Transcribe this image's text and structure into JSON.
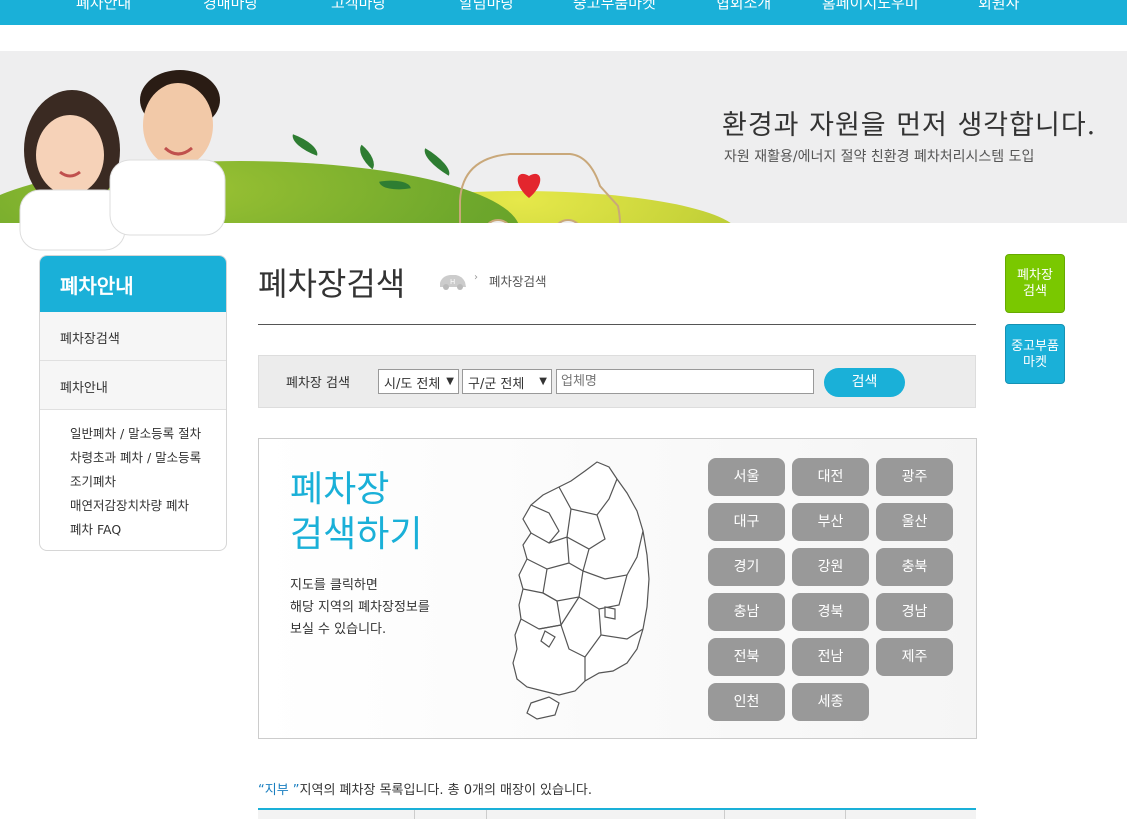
{
  "nav": {
    "items": [
      "폐차안내",
      "경매마당",
      "고객마당",
      "알림마당",
      "중고부품마켓",
      "협회소개",
      "홈페이지도우미",
      "회원사"
    ]
  },
  "banner": {
    "tagline": "환경과 자원을 먼저 생각합니다.",
    "subline": "자원 재활용/에너지 절약 친환경 폐차처리시스템 도입"
  },
  "sidebar": {
    "title": "폐차안내",
    "items": [
      "폐차장검색",
      "폐차안내"
    ],
    "subitems": [
      "일반폐차 / 말소등록 절차",
      "차령초과 폐차 / 말소등록",
      "조기폐차",
      "매연저감장치차량 폐차",
      "폐차 FAQ"
    ]
  },
  "page": {
    "title": "폐차장검색",
    "breadcrumb": "폐차장검색"
  },
  "search": {
    "label": "폐차장 검색",
    "sido": "시/도 전체",
    "gugun": "구/군 전체",
    "placeholder": "업체명",
    "button": "검색"
  },
  "map": {
    "title_line1": "폐차장",
    "title_line2": "검색하기",
    "desc": [
      "지도를 클릭하면",
      "해당 지역의 폐차장정보를",
      "보실 수 있습니다."
    ],
    "regions": [
      "서울",
      "대전",
      "광주",
      "대구",
      "부산",
      "울산",
      "경기",
      "강원",
      "충북",
      "충남",
      "경북",
      "경남",
      "전북",
      "전남",
      "제주",
      "인천",
      "세종"
    ]
  },
  "list": {
    "region": "“지부 ”",
    "text": "지역의 폐차장 목록입니다. 총 0개의 매장이 있습니다."
  },
  "quick": {
    "btn1": [
      "폐차장",
      "검색"
    ],
    "btn2": [
      "중고부품",
      "마켓"
    ]
  },
  "colors": {
    "accent": "#1ab0d8",
    "green": "#7ac800",
    "region_button": "#999999"
  }
}
